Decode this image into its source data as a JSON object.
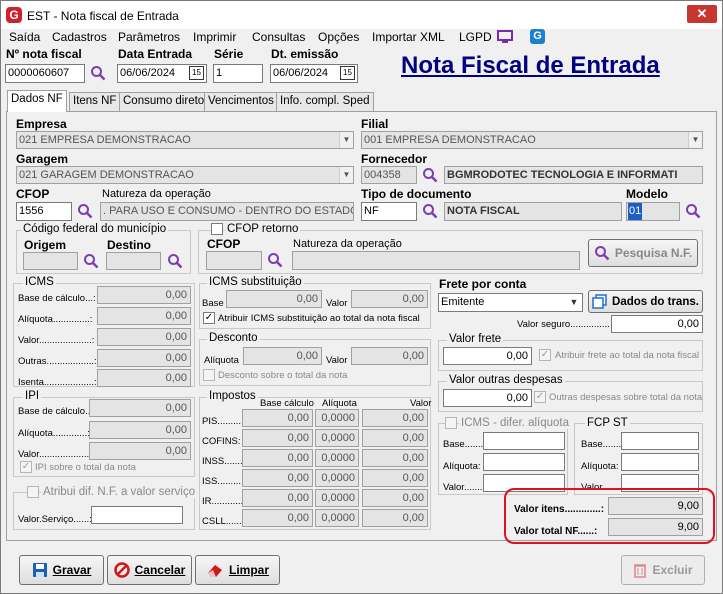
{
  "window": {
    "title": "EST - Nota fiscal de Entrada",
    "logo_letter": "G"
  },
  "menu": [
    "Saída",
    "Cadastros",
    "Parâmetros",
    "Imprimir",
    "Consultas",
    "Opções",
    "Importar XML",
    "LGPD"
  ],
  "header": {
    "nota_fiscal_label": "Nº nota fiscal",
    "nota_fiscal_value": "0000060607",
    "data_entrada_label": "Data Entrada",
    "data_entrada_value": "06/06/2024",
    "serie_label": "Série",
    "serie_value": "1",
    "dt_emissao_label": "Dt. emissão",
    "dt_emissao_value": "06/06/2024",
    "page_title": "Nota Fiscal de Entrada",
    "calendar_glyph": "15"
  },
  "tabs": [
    "Dados NF",
    "Itens NF",
    "Consumo direto",
    "Vencimentos",
    "Info. compl. Sped"
  ],
  "form": {
    "empresa_label": "Empresa",
    "empresa_value": "021 EMPRESA DEMONSTRACAO",
    "filial_label": "Filial",
    "filial_value": "001 EMPRESA DEMONSTRACAO",
    "garagem_label": "Garagem",
    "garagem_value": "021 GARAGEM DEMONSTRACAO",
    "fornecedor_label": "Fornecedor",
    "fornecedor_code": "004358",
    "fornecedor_name": "BGMRODOTEC TECNOLOGIA E INFORMATI",
    "cfop_label": "CFOP",
    "cfop_value": "1556",
    "natureza_label": "Natureza da operação",
    "natureza_value": ". PARA USO E CONSUMO - DENTRO DO ESTADO",
    "tipo_doc_label": "Tipo de documento",
    "tipo_doc_code": "NF",
    "tipo_doc_name": "NOTA FISCAL",
    "modelo_label": "Modelo",
    "modelo_value": "01",
    "cod_municipio_title": "Código federal do município",
    "origem_label": "Origem",
    "destino_label": "Destino",
    "cfop_retorno_label": "CFOP retorno",
    "cfop_ret_label": "CFOP",
    "natureza_ret_label": "Natureza da operação",
    "pesquisa_nf_label": "Pesquisa N.F."
  },
  "icms": {
    "title": "ICMS",
    "rows": [
      {
        "label": "Base de cálculo...:",
        "value": "0,00"
      },
      {
        "label": "Alíquota..............:",
        "value": "0,00"
      },
      {
        "label": "Valor....................:",
        "value": "0,00"
      },
      {
        "label": "Outras..................:",
        "value": "0,00"
      },
      {
        "label": "Isenta...................:",
        "value": "0,00"
      }
    ]
  },
  "icms_st": {
    "title": "ICMS substituição",
    "base_label": "Base",
    "base_value": "0,00",
    "valor_label": "Valor",
    "valor_value": "0,00",
    "chk_label": "Atribuir ICMS substituição ao total da nota fiscal",
    "chk_mark": "✓"
  },
  "desconto": {
    "title": "Desconto",
    "aliq_label": "Alíquota",
    "aliq_value": "0,00",
    "valor_label": "Valor",
    "valor_value": "0,00",
    "chk_label": "Desconto sobre o total da nota"
  },
  "ipi": {
    "title": "IPI",
    "rows": [
      {
        "label": "Base de cálculo..:",
        "value": "0,00"
      },
      {
        "label": "Alíquota.............:",
        "value": "0,00"
      },
      {
        "label": "Valor...................:",
        "value": "0,00"
      }
    ],
    "chk_label": "IPI sobre o total da nota",
    "chk_mark": "✓"
  },
  "impostos": {
    "title": "Impostos",
    "col_base": "Base cálculo",
    "col_aliq": "Alíquota",
    "col_valor": "Valor",
    "rows": [
      {
        "label": "PIS..........:",
        "base": "0,00",
        "aliq": "0,0000",
        "valor": "0,00"
      },
      {
        "label": "COFINS:",
        "base": "0,00",
        "aliq": "0,0000",
        "valor": "0,00"
      },
      {
        "label": "INSS.........:",
        "base": "0,00",
        "aliq": "0,0000",
        "valor": "0,00"
      },
      {
        "label": "ISS..........:",
        "base": "0,00",
        "aliq": "0,0000",
        "valor": "0,00"
      },
      {
        "label": "IR.............:",
        "base": "0,00",
        "aliq": "0,0000",
        "valor": "0,00"
      },
      {
        "label": "CSLL.........:",
        "base": "0,00",
        "aliq": "0,0000",
        "valor": "0,00"
      }
    ]
  },
  "atribuir_dif": {
    "chk_label": "Atribui dif. N.F. a valor serviço",
    "valor_servico_label": "Valor.Serviço......:"
  },
  "frete": {
    "label": "Frete por conta",
    "value": "Emitente",
    "dados_trans_label": "Dados do trans.",
    "valor_seguro_label": "Valor seguro...............",
    "valor_seguro_value": "0,00",
    "valor_frete_title": "Valor frete",
    "valor_frete_value": "0,00",
    "atribuir_frete_label": "Atribuir frete ao total da nota fiscal",
    "chk_mark": "✓"
  },
  "outras_despesas": {
    "title": "Valor outras despesas",
    "value": "0,00",
    "chk_label": "Outras despesas sobre total da nota",
    "chk_mark": "✓"
  },
  "icms_dif": {
    "title": "ICMS - difer. alíquota",
    "rows": [
      "Base.......:",
      "Alíquota:",
      "Valor.......:"
    ]
  },
  "fcp_st": {
    "title": "FCP ST",
    "rows": [
      "Base.......:",
      "Alíquota:",
      "Valor.......:"
    ]
  },
  "totais": {
    "valor_itens_label": "Valor itens.............:",
    "valor_itens_value": "9,00",
    "valor_total_label": "Valor total NF......:",
    "valor_total_value": "9,00"
  },
  "buttons": {
    "gravar": "Gravar",
    "cancelar": "Cancelar",
    "limpar": "Limpar",
    "excluir": "Excluir"
  },
  "colors": {
    "title_blue": "#000080",
    "highlight": "#e01020",
    "accent": "#0a66c2"
  }
}
